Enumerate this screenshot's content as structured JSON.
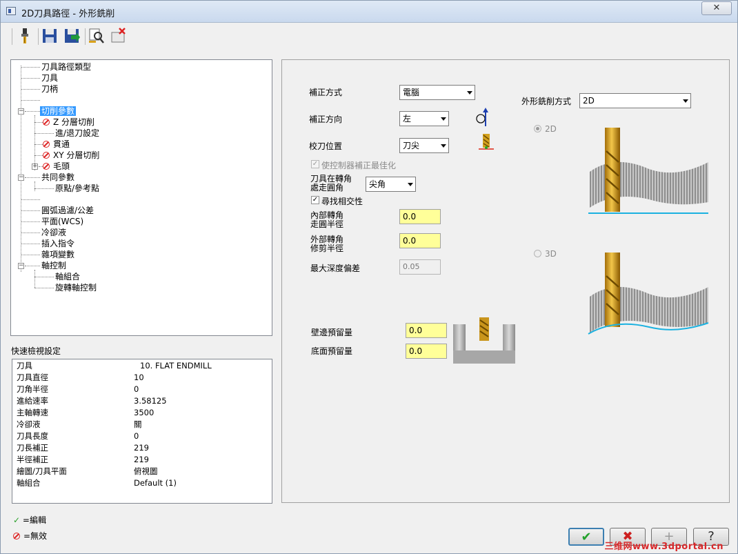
{
  "window": {
    "title": "2D刀具路徑 - 外形銑削",
    "close_label": "✕"
  },
  "toolbar": {
    "icons": [
      "tool-icon",
      "save-icon",
      "save-as-icon",
      "view-icon",
      "delete-icon"
    ]
  },
  "tree": {
    "items": [
      {
        "label": "刀具路徑類型"
      },
      {
        "label": "刀具"
      },
      {
        "label": "刀柄"
      },
      {
        "label": "切削參數"
      },
      {
        "label": "Z 分層切削"
      },
      {
        "label": "進/退刀設定"
      },
      {
        "label": "貫通"
      },
      {
        "label": "XY 分層切削"
      },
      {
        "label": "毛頭"
      },
      {
        "label": "共同參數"
      },
      {
        "label": "原點/參考點"
      },
      {
        "label": "圓弧過濾/公差"
      },
      {
        "label": "平面(WCS)"
      },
      {
        "label": "冷卻液"
      },
      {
        "label": "插入指令"
      },
      {
        "label": "雜項變數"
      },
      {
        "label": "軸控制"
      },
      {
        "label": "軸組合"
      },
      {
        "label": "旋轉軸控制"
      }
    ]
  },
  "quickview": {
    "title": "快速檢視設定",
    "rows": [
      {
        "k": "刀具",
        "v": "10. FLAT ENDMILL"
      },
      {
        "k": "刀具直徑",
        "v": "10"
      },
      {
        "k": "刀角半徑",
        "v": "0"
      },
      {
        "k": "進給速率",
        "v": "3.58125"
      },
      {
        "k": "主軸轉速",
        "v": "3500"
      },
      {
        "k": "冷卻液",
        "v": "關"
      },
      {
        "k": "刀具長度",
        "v": "0"
      },
      {
        "k": "刀長補正",
        "v": "219"
      },
      {
        "k": "半徑補正",
        "v": "219"
      },
      {
        "k": "繪圖/刀具平面",
        "v": "俯視圖"
      },
      {
        "k": "軸組合",
        "v": "Default (1)"
      }
    ]
  },
  "legend": {
    "edit": "=編輯",
    "invalid": "=無效"
  },
  "form": {
    "comp_type_label": "補正方式",
    "comp_type_value": "電腦",
    "comp_dir_label": "補正方向",
    "comp_dir_value": "左",
    "tip_comp_label": "校刀位置",
    "tip_comp_value": "刀尖",
    "optimize_label": "使控制器補正最佳化",
    "corner_label_1": "刀具在轉角",
    "corner_label_2": "處走圓角",
    "corner_value": "尖角",
    "intersect_label": "尋找相交性",
    "inner_label_1": "內部轉角",
    "inner_label_2": "走圓半徑",
    "inner_value": "0.0",
    "outer_label_1": "外部轉角",
    "outer_label_2": "修剪半徑",
    "outer_value": "0.0",
    "max_depth_label": "最大深度偏差",
    "max_depth_value": "0.05",
    "wall_stock_label": "壁邊預留量",
    "wall_stock_value": "0.0",
    "floor_stock_label": "底面預留量",
    "floor_stock_value": "0.0",
    "contour_type_label": "外形銑削方式",
    "contour_type_value": "2D",
    "radio_2d": "2D",
    "radio_3d": "3D"
  },
  "buttons": {
    "ok": "✔",
    "cancel": "✖",
    "add": "+",
    "help": "?"
  },
  "watermark": "三维网www.3dportal.cn"
}
